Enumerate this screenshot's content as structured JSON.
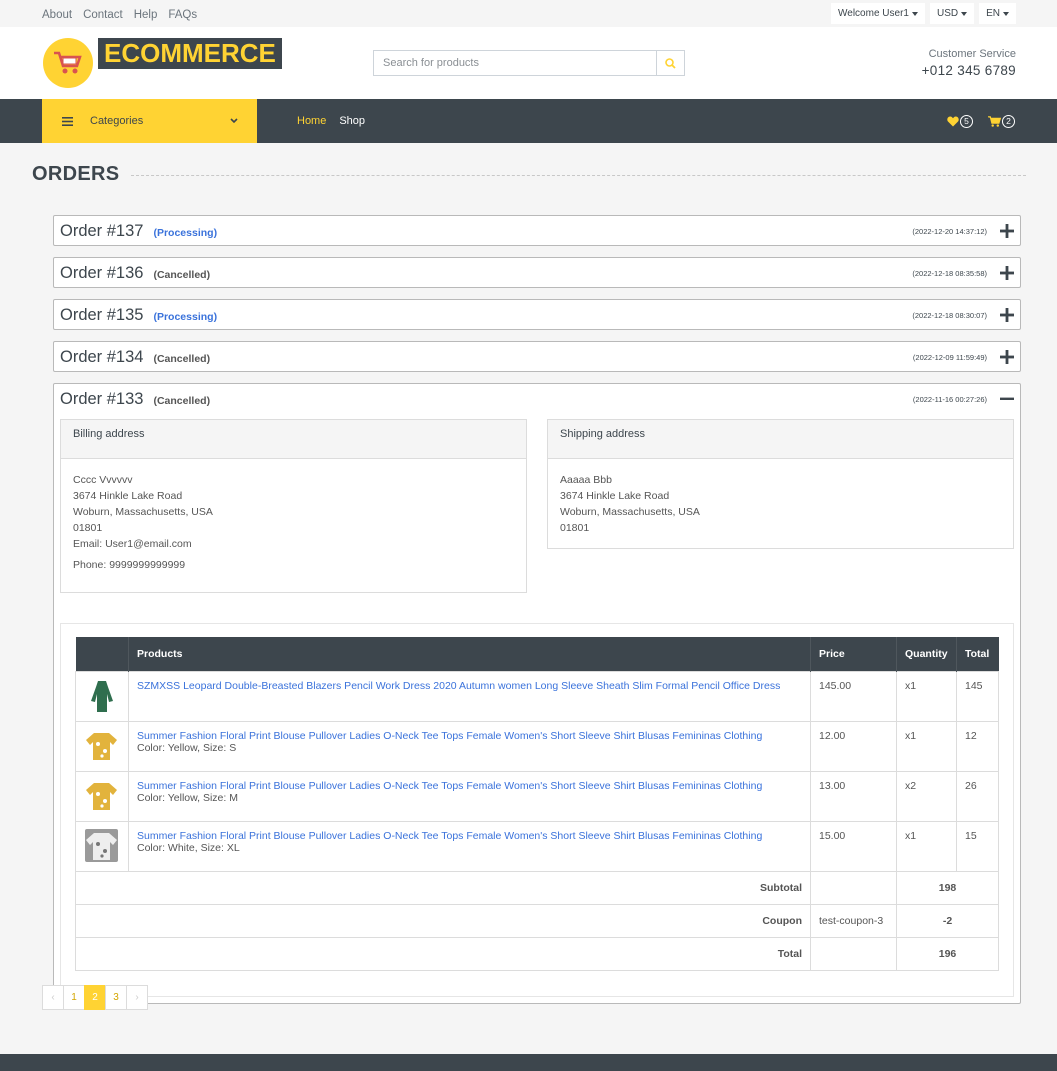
{
  "topbar": {
    "links": [
      "About",
      "Contact",
      "Help",
      "FAQs"
    ],
    "welcome": "Welcome User1",
    "currency": "USD",
    "language": "EN"
  },
  "header": {
    "logo_text": "ECOMMERCE",
    "search_placeholder": "Search for products",
    "cs_label": "Customer Service",
    "cs_phone": "+012 345 6789"
  },
  "navbar": {
    "categories_label": "Categories",
    "home": "Home",
    "shop": "Shop",
    "wishlist_count": "5",
    "cart_count": "2"
  },
  "page_title": "ORDERS",
  "orders": [
    {
      "number": "Order #137",
      "status": "(Processing)",
      "date": "(2022-12-20 14:37:12)"
    },
    {
      "number": "Order #136",
      "status": "(Cancelled)",
      "date": "(2022-12-18 08:35:58)"
    },
    {
      "number": "Order #135",
      "status": "(Processing)",
      "date": "(2022-12-18 08:30:07)"
    },
    {
      "number": "Order #134",
      "status": "(Cancelled)",
      "date": "(2022-12-09 11:59:49)"
    },
    {
      "number": "Order #133",
      "status": "(Cancelled)",
      "date": "(2022-11-16 00:27:26)"
    }
  ],
  "open_order": {
    "billing": {
      "title": "Billing address",
      "name": "Cccc Vvvvvv",
      "street": "3674 Hinkle Lake Road",
      "city": "Woburn, Massachusetts, USA",
      "zip": "01801",
      "email": "Email: User1@email.com",
      "phone": "Phone: 9999999999999"
    },
    "shipping": {
      "title": "Shipping address",
      "name": "Aaaaa Bbb",
      "street": "3674 Hinkle Lake Road",
      "city": "Woburn, Massachusetts, USA",
      "zip": "01801"
    },
    "table_headers": [
      "Products",
      "Price",
      "Quantity",
      "Total"
    ],
    "items": [
      {
        "name": "SZMXSS Leopard Double-Breasted Blazers Pencil Work Dress 2020 Autumn women Long Sleeve Sheath Slim Formal Pencil Office Dress",
        "variant": "",
        "price": "145.00",
        "qty": "x1",
        "total": "145",
        "thumb_color": "#2f6e4e"
      },
      {
        "name": "Summer Fashion Floral Print Blouse Pullover Ladies O-Neck Tee Tops Female Women's Short Sleeve Shirt Blusas Femininas Clothing",
        "variant": "Color: Yellow, Size: S",
        "price": "12.00",
        "qty": "x1",
        "total": "12",
        "thumb_color": "#e2b33c"
      },
      {
        "name": "Summer Fashion Floral Print Blouse Pullover Ladies O-Neck Tee Tops Female Women's Short Sleeve Shirt Blusas Femininas Clothing",
        "variant": "Color: Yellow, Size: M",
        "price": "13.00",
        "qty": "x2",
        "total": "26",
        "thumb_color": "#e2b33c"
      },
      {
        "name": "Summer Fashion Floral Print Blouse Pullover Ladies O-Neck Tee Tops Female Women's Short Sleeve Shirt Blusas Femininas Clothing",
        "variant": "Color: White, Size: XL",
        "price": "15.00",
        "qty": "x1",
        "total": "15",
        "thumb_color": "#cfcfcf"
      }
    ],
    "subtotal_label": "Subtotal",
    "subtotal": "198",
    "coupon_label": "Coupon",
    "coupon_code": "test-coupon-3",
    "coupon_value": "-2",
    "total_label": "Total",
    "total": "196"
  },
  "pagination": {
    "prev": "‹",
    "pages": [
      "1",
      "2",
      "3"
    ],
    "current": "2",
    "next": "›"
  },
  "colors": {
    "accent": "#ffd333",
    "dark": "#3d464d",
    "link": "#3a72db"
  }
}
